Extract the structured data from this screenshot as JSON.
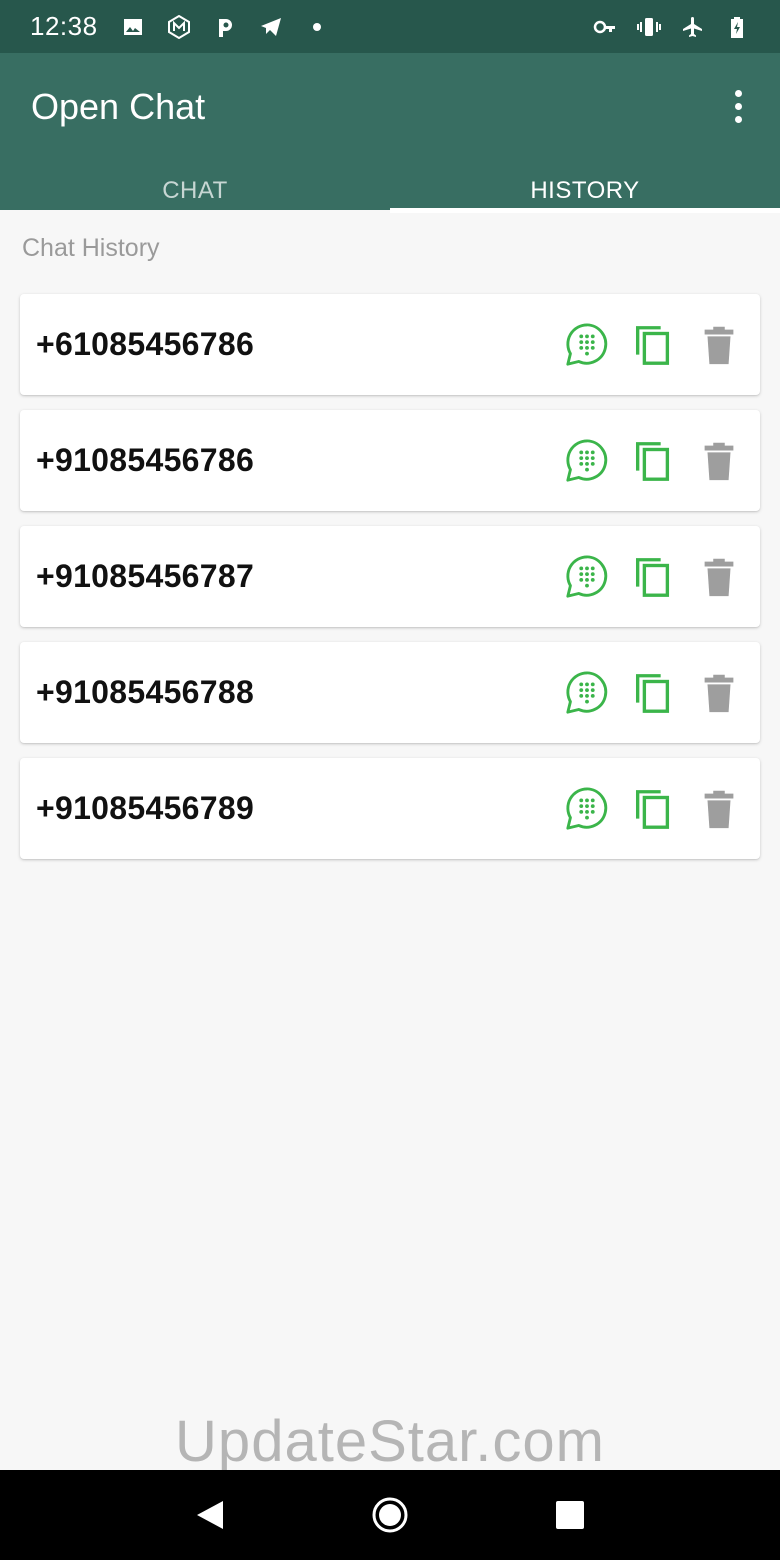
{
  "status_bar": {
    "time": "12:38",
    "left_icons": [
      "image-icon",
      "m-badge-icon",
      "p-logo-icon",
      "telegram-icon",
      "dot-icon"
    ],
    "right_icons": [
      "vpn-key-icon",
      "vibrate-icon",
      "airplane-icon",
      "battery-charging-icon"
    ]
  },
  "app_bar": {
    "title": "Open Chat",
    "menu_icon": "more-vert-icon"
  },
  "tabs": [
    {
      "label": "CHAT",
      "active": false
    },
    {
      "label": "HISTORY",
      "active": true
    }
  ],
  "section": {
    "label": "Chat History"
  },
  "history": [
    {
      "number": "+61085456786"
    },
    {
      "number": "+91085456786"
    },
    {
      "number": "+91085456787"
    },
    {
      "number": "+91085456788"
    },
    {
      "number": "+91085456789"
    }
  ],
  "actions": {
    "open_chat_icon": "whatsapp-chat-icon",
    "copy_icon": "copy-icon",
    "delete_icon": "trash-icon"
  },
  "watermark": "UpdateStar.com",
  "nav_bar": {
    "icons": [
      "back-icon",
      "home-icon",
      "recents-icon"
    ]
  },
  "colors": {
    "status_bar": "#27574c",
    "app_bar": "#386e62",
    "action_green": "#3bb54a",
    "delete_gray": "#9e9e9e",
    "background": "#f7f7f7"
  }
}
